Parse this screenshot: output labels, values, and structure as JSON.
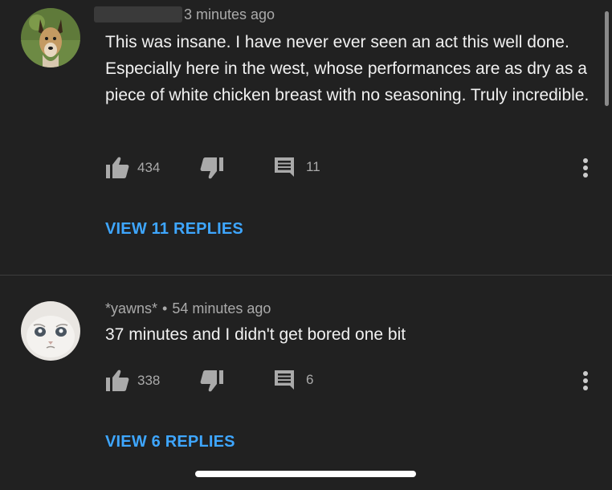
{
  "comments": [
    {
      "author": "",
      "time": "3 minutes ago",
      "text": "This was insane. I have never ever seen an act this well done. Especially here in the west, whose performances are as dry as a piece of white chicken breast with no seasoning. Truly incredible.",
      "likes": "434",
      "replies_count": "11",
      "view_replies": "VIEW 11 REPLIES",
      "avatar_icon": "dog-avatar"
    },
    {
      "author": "*yawns*",
      "separator": "•",
      "time": "54 minutes ago",
      "text": "37 minutes and I didn't get bored one bit",
      "likes": "338",
      "replies_count": "6",
      "view_replies": "VIEW 6 REPLIES",
      "avatar_icon": "cat-avatar"
    }
  ],
  "colors": {
    "background": "#212121",
    "link": "#3ea6ff",
    "secondary_text": "#aaaaaa"
  }
}
